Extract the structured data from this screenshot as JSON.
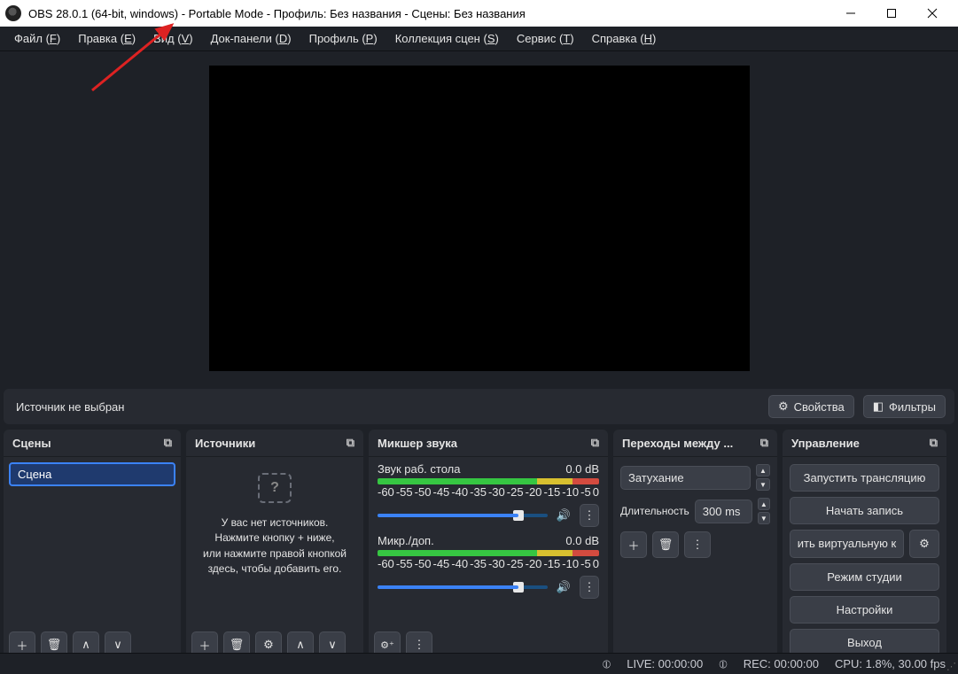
{
  "window": {
    "title": "OBS 28.0.1 (64-bit, windows) - Portable Mode - Профиль: Без названия - Сцены: Без названия"
  },
  "menu": {
    "file": "Файл",
    "file_k": "F",
    "edit": "Правка",
    "edit_k": "E",
    "view": "Вид",
    "view_k": "V",
    "docks": "Док-панели",
    "docks_k": "D",
    "profile": "Профиль",
    "profile_k": "P",
    "scenes": "Коллекция сцен",
    "scenes_k": "S",
    "tools": "Сервис",
    "tools_k": "T",
    "help": "Справка",
    "help_k": "H"
  },
  "sourcebar": {
    "none": "Источник не выбран",
    "props": "Свойства",
    "filters": "Фильтры"
  },
  "panels": {
    "scenes": "Сцены",
    "sources": "Источники",
    "mixer": "Микшер звука",
    "trans": "Переходы между ...",
    "controls": "Управление"
  },
  "scenes": {
    "items": [
      "Сцена"
    ]
  },
  "sources": {
    "empty": "У вас нет источников.\nНажмите кнопку + ниже,\nили нажмите правой кнопкой\nздесь, чтобы добавить его."
  },
  "mixer": {
    "desk_name": "Звук раб. стола",
    "desk_db": "0.0 dB",
    "mic_name": "Микр./доп.",
    "mic_db": "0.0 dB",
    "ticks": [
      "-60",
      "-55",
      "-50",
      "-45",
      "-40",
      "-35",
      "-30",
      "-25",
      "-20",
      "-15",
      "-10",
      "-5",
      "0"
    ]
  },
  "transitions": {
    "type": "Затухание",
    "dur_label": "Длительность",
    "dur_value": "300 ms"
  },
  "controls": {
    "stream": "Запустить трансляцию",
    "record": "Начать запись",
    "vcam": "ить виртуальную к",
    "studio": "Режим студии",
    "settings": "Настройки",
    "exit": "Выход"
  },
  "status": {
    "live": "LIVE: 00:00:00",
    "rec": "REC: 00:00:00",
    "cpu": "CPU: 1.8%, 30.00 fps"
  }
}
